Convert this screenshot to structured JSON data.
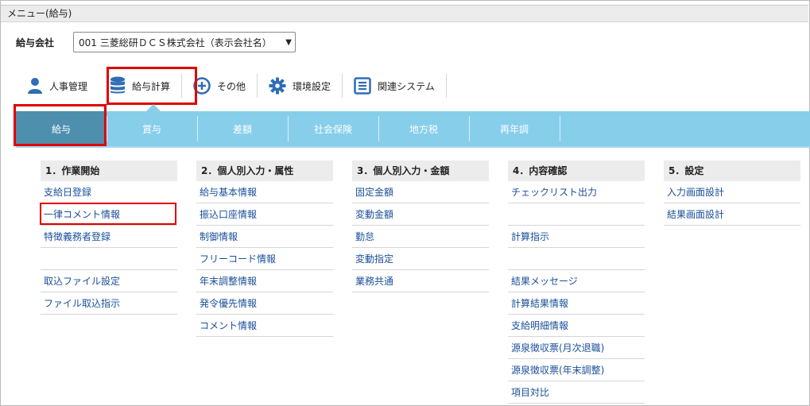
{
  "window": {
    "title": "メニュー(給与)"
  },
  "company": {
    "label": "給与会社",
    "selected": "001 三菱総研ＤＣＳ株式会社（表示会社名）"
  },
  "topnav": [
    {
      "label": "人事管理",
      "icon": "person-icon"
    },
    {
      "label": "給与計算",
      "icon": "database-icon"
    },
    {
      "label": "その他",
      "icon": "plus-circle-icon"
    },
    {
      "label": "環境設定",
      "icon": "gear-icon"
    },
    {
      "label": "関連システム",
      "icon": "list-box-icon"
    }
  ],
  "tabs": [
    "給与",
    "賞与",
    "差額",
    "社会保険",
    "地方税",
    "再年調"
  ],
  "columns": [
    {
      "title": "1．作業開始",
      "items": [
        "支給日登録",
        "一律コメント情報",
        "特徴義務者登録",
        "",
        "取込ファイル設定",
        "ファイル取込指示"
      ]
    },
    {
      "title": "2．個人別入力・属性",
      "items": [
        "給与基本情報",
        "振込口座情報",
        "制御情報",
        "フリーコード情報",
        "年末調整情報",
        "発令優先情報",
        "コメント情報"
      ]
    },
    {
      "title": "3．個人別入力・金額",
      "items": [
        "固定金額",
        "変動金額",
        "勤怠",
        "変動指定",
        "業務共通"
      ]
    },
    {
      "title": "4．内容確認",
      "items": [
        "チェックリスト出力",
        "",
        "計算指示",
        "",
        "結果メッセージ",
        "計算結果情報",
        "支給明細情報",
        "源泉徴収票(月次退職)",
        "源泉徴収票(年末調整)",
        "項目対比"
      ]
    },
    {
      "title": "5．設定",
      "items": [
        "入力画面設計",
        "結果画面設計"
      ]
    }
  ],
  "colors": {
    "tab_bar": "#87ceeb",
    "tab_active": "#4e8fae",
    "link": "#1a4f99",
    "highlight": "#e00000",
    "icon_blue": "#2f6db5"
  }
}
